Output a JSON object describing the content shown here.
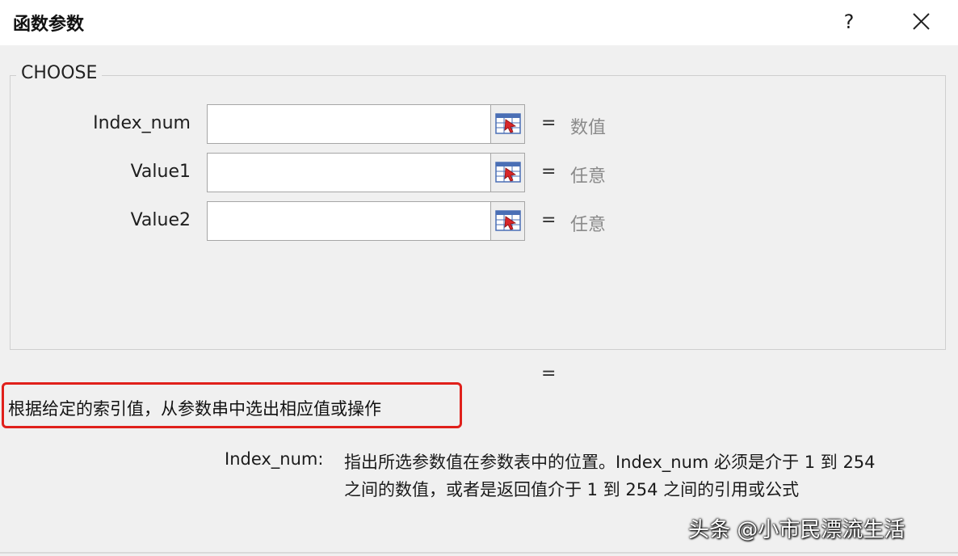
{
  "dialog": {
    "title": "函数参数",
    "help_label": "?",
    "close_icon": "close-icon"
  },
  "function": {
    "name": "CHOOSE",
    "args": [
      {
        "label": "Index_num",
        "value": "",
        "equals": "=",
        "result_hint": "数值"
      },
      {
        "label": "Value1",
        "value": "",
        "equals": "=",
        "result_hint": "任意"
      },
      {
        "label": "Value2",
        "value": "",
        "equals": "=",
        "result_hint": "任意"
      }
    ],
    "ref_icon": "range-select-icon",
    "overall_equals": "="
  },
  "description": "根据给定的索引值，从参数串中选出相应值或操作",
  "highlight_color": "#e0201b",
  "arg_description": {
    "name": "Index_num:",
    "line1": "指出所选参数值在参数表中的位置。Index_num 必须是介于 1 到 254",
    "line2": "之间的数值，或者是返回值介于 1 到 254 之间的引用或公式"
  },
  "watermark": "头条 @小市民漂流生活"
}
